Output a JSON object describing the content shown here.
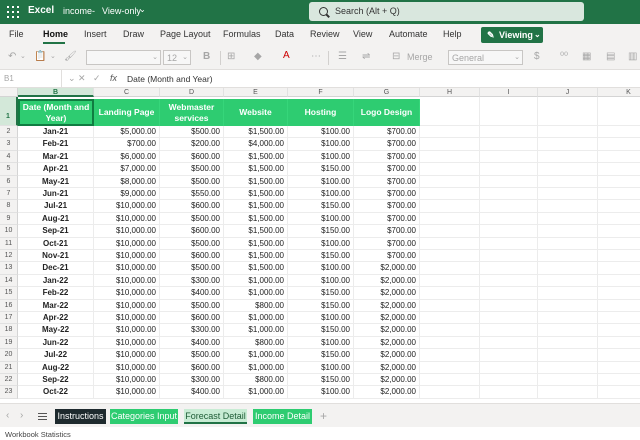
{
  "titlebar": {
    "app": "Excel",
    "doc": "income",
    "mode": "View-only",
    "search_placeholder": "Search (Alt + Q)",
    "color": "#217346"
  },
  "ribbon": {
    "tabs": [
      "File",
      "Home",
      "Insert",
      "Draw",
      "Page Layout",
      "Formulas",
      "Data",
      "Review",
      "View",
      "Automate",
      "Help"
    ],
    "active": "Home",
    "viewing": "Viewing"
  },
  "toolbar": {
    "font_size": "12",
    "merge": "Merge",
    "number_format": "General"
  },
  "formula": {
    "namebox": "B1",
    "fx": "fx",
    "content": "Date (Month and Year)"
  },
  "grid": {
    "columns": [
      "B",
      "C",
      "D",
      "E",
      "F",
      "G",
      "H",
      "I",
      "J",
      "K"
    ],
    "headers": [
      "Date (Month and Year)",
      "Landing Page",
      "Webmaster services",
      "Website",
      "Hosting",
      "Logo Design"
    ],
    "header_color": "#2ecc71",
    "rows": [
      [
        "Jan-21",
        "$5,000.00",
        "$500.00",
        "$1,500.00",
        "$100.00",
        "$700.00"
      ],
      [
        "Feb-21",
        "$700.00",
        "$200.00",
        "$4,000.00",
        "$100.00",
        "$700.00"
      ],
      [
        "Mar-21",
        "$6,000.00",
        "$600.00",
        "$1,500.00",
        "$100.00",
        "$700.00"
      ],
      [
        "Apr-21",
        "$7,000.00",
        "$500.00",
        "$1,500.00",
        "$150.00",
        "$700.00"
      ],
      [
        "May-21",
        "$8,000.00",
        "$500.00",
        "$1,500.00",
        "$100.00",
        "$700.00"
      ],
      [
        "Jun-21",
        "$9,000.00",
        "$550.00",
        "$1,500.00",
        "$100.00",
        "$700.00"
      ],
      [
        "Jul-21",
        "$10,000.00",
        "$600.00",
        "$1,500.00",
        "$150.00",
        "$700.00"
      ],
      [
        "Aug-21",
        "$10,000.00",
        "$500.00",
        "$1,500.00",
        "$100.00",
        "$700.00"
      ],
      [
        "Sep-21",
        "$10,000.00",
        "$600.00",
        "$1,500.00",
        "$150.00",
        "$700.00"
      ],
      [
        "Oct-21",
        "$10,000.00",
        "$500.00",
        "$1,500.00",
        "$100.00",
        "$700.00"
      ],
      [
        "Nov-21",
        "$10,000.00",
        "$600.00",
        "$1,500.00",
        "$150.00",
        "$700.00"
      ],
      [
        "Dec-21",
        "$10,000.00",
        "$500.00",
        "$1,500.00",
        "$100.00",
        "$2,000.00"
      ],
      [
        "Jan-22",
        "$10,000.00",
        "$300.00",
        "$1,000.00",
        "$100.00",
        "$2,000.00"
      ],
      [
        "Feb-22",
        "$10,000.00",
        "$400.00",
        "$1,000.00",
        "$150.00",
        "$2,000.00"
      ],
      [
        "Mar-22",
        "$10,000.00",
        "$500.00",
        "$800.00",
        "$150.00",
        "$2,000.00"
      ],
      [
        "Apr-22",
        "$10,000.00",
        "$600.00",
        "$1,000.00",
        "$100.00",
        "$2,000.00"
      ],
      [
        "May-22",
        "$10,000.00",
        "$300.00",
        "$1,000.00",
        "$150.00",
        "$2,000.00"
      ],
      [
        "Jun-22",
        "$10,000.00",
        "$400.00",
        "$800.00",
        "$100.00",
        "$2,000.00"
      ],
      [
        "Jul-22",
        "$10,000.00",
        "$500.00",
        "$1,000.00",
        "$150.00",
        "$2,000.00"
      ],
      [
        "Aug-22",
        "$10,000.00",
        "$600.00",
        "$1,000.00",
        "$100.00",
        "$2,000.00"
      ],
      [
        "Sep-22",
        "$10,000.00",
        "$300.00",
        "$800.00",
        "$150.00",
        "$2,000.00"
      ],
      [
        "Oct-22",
        "$10,000.00",
        "$400.00",
        "$1,000.00",
        "$100.00",
        "$2,000.00"
      ]
    ]
  },
  "sheets": {
    "tabs": [
      "Instructions",
      "Categories Input",
      "Forecast Detail",
      "Income Detail"
    ],
    "active": "Forecast Detail"
  },
  "status": {
    "text": "Workbook Statistics"
  }
}
